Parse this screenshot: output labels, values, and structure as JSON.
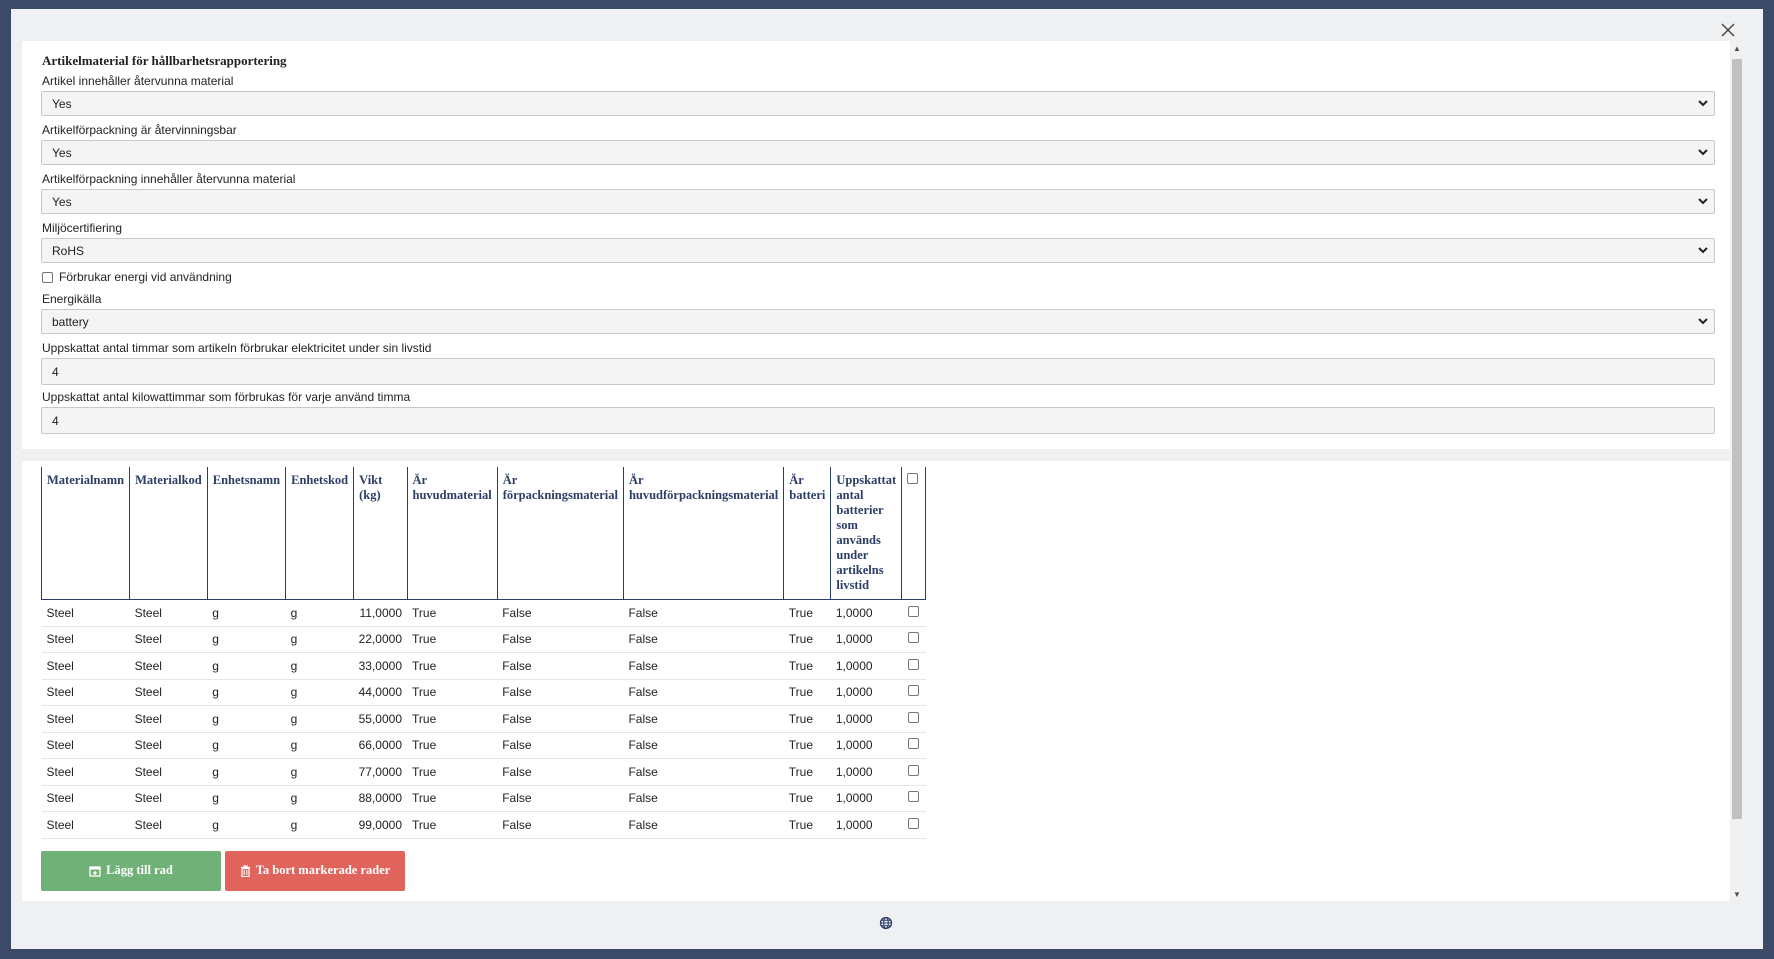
{
  "form": {
    "title": "Artikelmaterial för hållbarhetsrapportering",
    "recycled_material": {
      "label": "Artikel innehåller återvunna material",
      "value": "Yes"
    },
    "packaging_recyclable": {
      "label": "Artikelförpackning är återvinningsbar",
      "value": "Yes"
    },
    "packaging_recycled": {
      "label": "Artikelförpackning innehåller återvunna material",
      "value": "Yes"
    },
    "eco_cert": {
      "label": "Miljöcertifiering",
      "value": "RoHS"
    },
    "energy_checkbox": {
      "label": "Förbrukar energi vid användning",
      "checked": false
    },
    "energy_source": {
      "label": "Energikälla",
      "value": "battery"
    },
    "hours": {
      "label": "Uppskattat antal timmar som artikeln förbrukar elektricitet under sin livstid",
      "value": "4"
    },
    "kwh": {
      "label": "Uppskattat antal kilowattimmar som förbrukas för varje använd timma",
      "value": "4"
    }
  },
  "table": {
    "headers": [
      "Materialnamn",
      "Materialkod",
      "Enhetsnamn",
      "Enhetskod",
      "Vikt (kg)",
      "Är huvudmaterial",
      "Är förpackningsmaterial",
      "Är huvudförpackningsmaterial",
      "Är batteri",
      "Uppskattat antal batterier som används under artikelns livstid"
    ],
    "rows": [
      [
        "Steel",
        "Steel",
        "g",
        "g",
        "11,0000",
        "True",
        "False",
        "False",
        "True",
        "1,0000"
      ],
      [
        "Steel",
        "Steel",
        "g",
        "g",
        "22,0000",
        "True",
        "False",
        "False",
        "True",
        "1,0000"
      ],
      [
        "Steel",
        "Steel",
        "g",
        "g",
        "33,0000",
        "True",
        "False",
        "False",
        "True",
        "1,0000"
      ],
      [
        "Steel",
        "Steel",
        "g",
        "g",
        "44,0000",
        "True",
        "False",
        "False",
        "True",
        "1,0000"
      ],
      [
        "Steel",
        "Steel",
        "g",
        "g",
        "55,0000",
        "True",
        "False",
        "False",
        "True",
        "1,0000"
      ],
      [
        "Steel",
        "Steel",
        "g",
        "g",
        "66,0000",
        "True",
        "False",
        "False",
        "True",
        "1,0000"
      ],
      [
        "Steel",
        "Steel",
        "g",
        "g",
        "77,0000",
        "True",
        "False",
        "False",
        "True",
        "1,0000"
      ],
      [
        "Steel",
        "Steel",
        "g",
        "g",
        "88,0000",
        "True",
        "False",
        "False",
        "True",
        "1,0000"
      ],
      [
        "Steel",
        "Steel",
        "g",
        "g",
        "99,0000",
        "True",
        "False",
        "False",
        "True",
        "1,0000"
      ]
    ]
  },
  "buttons": {
    "add_label": "Lägg till rad",
    "delete_label": "Ta bort markerade rader"
  },
  "colors": {
    "add": "#6fb176",
    "delete": "#e0645c",
    "header_text": "#2c3e66"
  }
}
